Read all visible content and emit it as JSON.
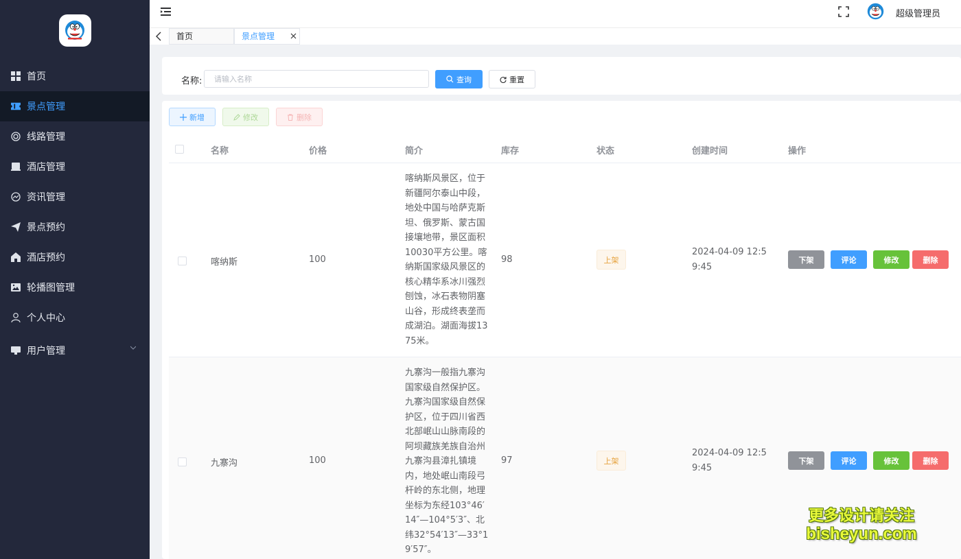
{
  "sidebar": {
    "items": [
      {
        "label": "首页",
        "icon": "dashboard-icon"
      },
      {
        "label": "景点管理",
        "icon": "ticket-icon",
        "active": true
      },
      {
        "label": "线路管理",
        "icon": "route-icon"
      },
      {
        "label": "酒店管理",
        "icon": "hotel-icon"
      },
      {
        "label": "资讯管理",
        "icon": "news-icon"
      },
      {
        "label": "景点预约",
        "icon": "send-icon"
      },
      {
        "label": "酒店预约",
        "icon": "home-icon"
      },
      {
        "label": "轮播图管理",
        "icon": "picture-icon"
      },
      {
        "label": "个人中心",
        "icon": "user-icon"
      },
      {
        "label": "用户管理",
        "icon": "monitor-icon",
        "has_submenu": true
      }
    ]
  },
  "header": {
    "admin_name": "超级管理员"
  },
  "tags": {
    "items": [
      {
        "label": "首页"
      },
      {
        "label": "景点管理",
        "active": true
      }
    ]
  },
  "search": {
    "label": "名称:",
    "placeholder": "请输入名称",
    "value": "",
    "query_label": "查询",
    "reset_label": "重置"
  },
  "toolbar": {
    "add_label": "新增",
    "edit_label": "修改",
    "delete_label": "删除"
  },
  "table": {
    "columns": [
      "名称",
      "价格",
      "简介",
      "库存",
      "状态",
      "创建时间",
      "操作"
    ],
    "rows": [
      {
        "name": "喀纳斯",
        "price": "100",
        "intro": "喀纳斯风景区，位于新疆阿尔泰山中段，地处中国与哈萨克斯坦、俄罗斯、蒙古国接壤地带，景区面积10030平方公里。喀纳斯国家级风景区的核心精华系冰川强烈刨蚀，冰石表物阴塞山谷，形成终表垄而成湖泊。湖面海拔1375米。",
        "stock": "98",
        "status": "上架",
        "created": "2024-04-09 12:59:45",
        "ops": {
          "off": "下架",
          "comment": "评论",
          "edit": "修改",
          "delete": "删除"
        }
      },
      {
        "name": "九寨沟",
        "price": "100",
        "intro": "九寨沟一般指九寨沟国家级自然保护区。九寨沟国家级自然保护区，位于四川省西北部岷山山脉南段的阿坝藏族羌族自治州九寨沟县漳扎镇境内，地处岷山南段弓杆岭的东北侧，地理坐标为东经103°46′14″—104°5′3″、北纬32°54′13″—33°19′57″。",
        "stock": "97",
        "status": "上架",
        "created": "2024-04-09 12:59:45",
        "ops": {
          "off": "下架",
          "comment": "评论",
          "edit": "修改",
          "delete": "删除"
        }
      }
    ]
  },
  "watermark": {
    "line1": "更多设计请关注",
    "line2": "bisheyun.com"
  },
  "colors": {
    "sidebar_bg": "#23283b",
    "primary": "#409eff",
    "success": "#67c23a",
    "danger": "#f56c6c",
    "warning": "#e6a23c",
    "info": "#909399"
  }
}
